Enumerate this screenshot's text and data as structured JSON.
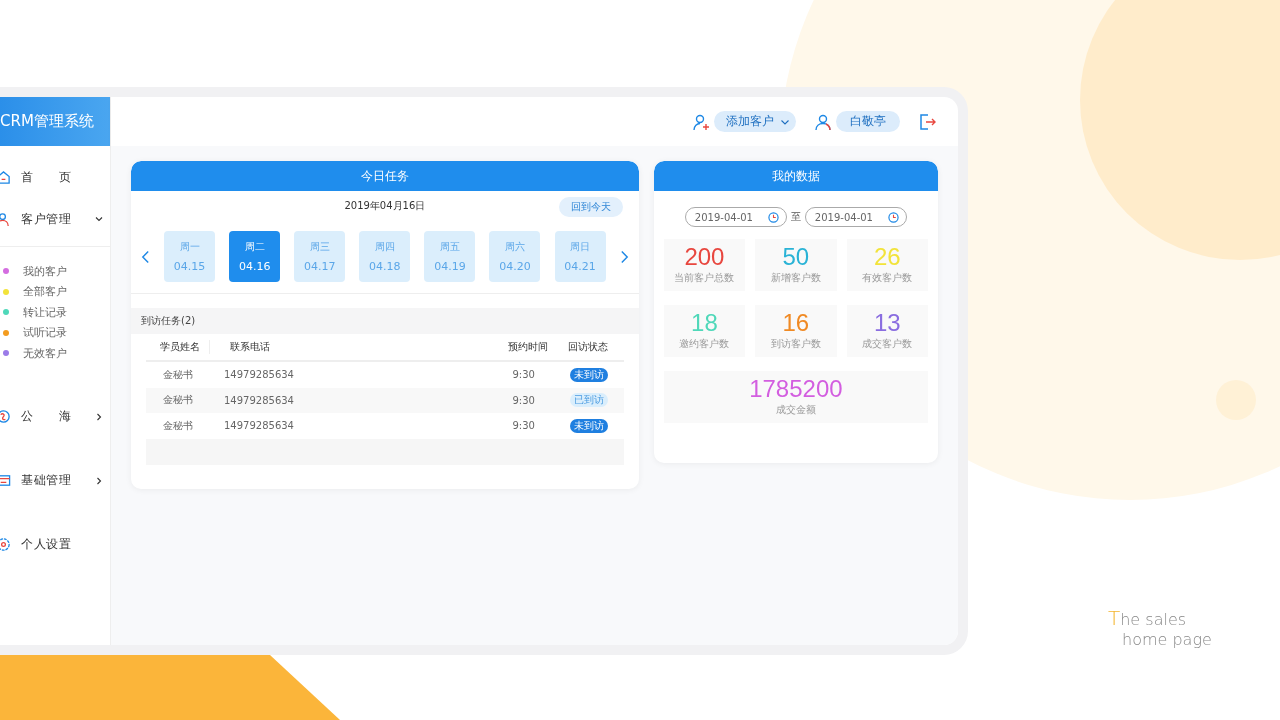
{
  "sidebar": {
    "title": "CRM管理系统",
    "items": [
      {
        "kind": "main",
        "label": "首 页"
      },
      {
        "kind": "main",
        "label": "客户管理",
        "expanded": true
      },
      {
        "kind": "sub",
        "label": "我的客户",
        "color": "#d46de0"
      },
      {
        "kind": "sub",
        "label": "全部客户",
        "color": "#f2e33a"
      },
      {
        "kind": "sub",
        "label": "转让记录",
        "color": "#4fd8b9"
      },
      {
        "kind": "sub",
        "label": "试听记录",
        "color": "#f39c1f"
      },
      {
        "kind": "sub",
        "label": "无效客户",
        "color": "#9b7be8"
      },
      {
        "kind": "main",
        "label": "公 海",
        "expanded": false
      },
      {
        "kind": "main",
        "label": "基础管理",
        "expanded": false
      },
      {
        "kind": "main",
        "label": "个人设置"
      }
    ]
  },
  "topbar": {
    "add_button": "添加客户",
    "user": "白敬亭"
  },
  "tasks": {
    "title": "今日任务",
    "date": "2019年04月16日",
    "today_button": "回到今天",
    "days": [
      {
        "weekday": "周一",
        "date": "04.15",
        "selected": false
      },
      {
        "weekday": "周二",
        "date": "04.16",
        "selected": true
      },
      {
        "weekday": "周三",
        "date": "04.17",
        "selected": false
      },
      {
        "weekday": "周四",
        "date": "04.18",
        "selected": false
      },
      {
        "weekday": "周五",
        "date": "04.19",
        "selected": false
      },
      {
        "weekday": "周六",
        "date": "04.20",
        "selected": false
      },
      {
        "weekday": "周日",
        "date": "04.21",
        "selected": false
      }
    ],
    "visits": {
      "title": "到访任务(2)",
      "columns": [
        "学员姓名",
        "联系电话",
        "预约时间",
        "回访状态"
      ],
      "rows": [
        {
          "name": "金秘书",
          "phone": "14979285634",
          "time": "9:30",
          "status": "未到访",
          "visited": false
        },
        {
          "name": "金秘书",
          "phone": "14979285634",
          "time": "9:30",
          "status": "已到访",
          "visited": true
        },
        {
          "name": "金秘书",
          "phone": "14979285634",
          "time": "9:30",
          "status": "未到访",
          "visited": false
        }
      ]
    }
  },
  "data": {
    "title": "我的数据",
    "from": "2019-04-01",
    "separator": "至",
    "to": "2019-04-01",
    "stats": [
      {
        "value": "200",
        "label": "当前客户总数",
        "color": "#e8473f"
      },
      {
        "value": "50",
        "label": "新增客户数",
        "color": "#2ab3d6"
      },
      {
        "value": "26",
        "label": "有效客户数",
        "color": "#f2e33a"
      },
      {
        "value": "18",
        "label": "邀约客户数",
        "color": "#4fd8b9"
      },
      {
        "value": "16",
        "label": "到访客户数",
        "color": "#f08a24"
      },
      {
        "value": "13",
        "label": "成交客户数",
        "color": "#8a6de0"
      }
    ],
    "total": {
      "value": "1785200",
      "label": "成交金额",
      "color": "#d35ee0"
    }
  },
  "tagline": [
    "The sales",
    "home page"
  ]
}
